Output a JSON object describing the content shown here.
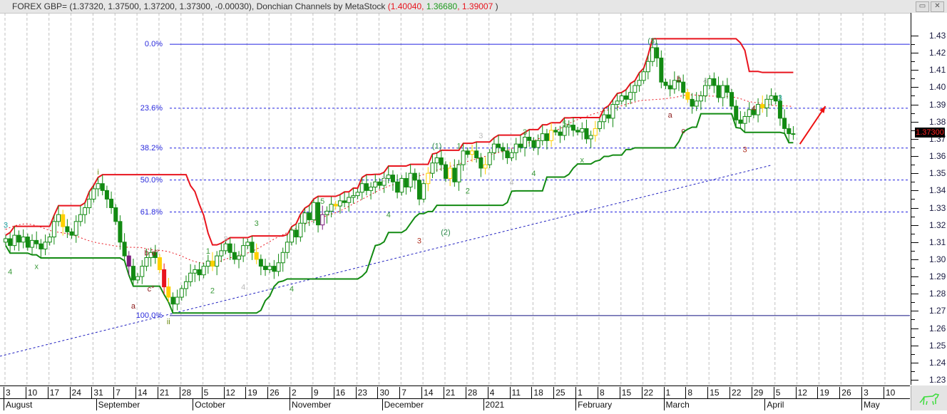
{
  "header": {
    "symbol": "FOREX GBP=",
    "ohlc_text": "(1.37320, 1.37500, 1.37200, 1.37300, -0.00030),",
    "indicator": "Donchian Channels by MetaStock",
    "ind_open": "(",
    "ind_upper": "1.40040",
    "ind_sep1": ",",
    "ind_lower": "1.36680",
    "ind_sep2": ",",
    "ind_mid": "1.39007",
    "ind_close": ")"
  },
  "window": {
    "restore_icon": "restore-icon",
    "close_icon": "close-icon",
    "restore": "▭",
    "close": "✕"
  },
  "last_price": "1.37300",
  "colors": {
    "upper": "#e8141e",
    "lower": "#128a12",
    "mid": "#e8141e",
    "candle": "#128a12",
    "fib": "#2020e0",
    "trend": "#2020c0",
    "arrow": "#ee1111"
  },
  "chart_data": {
    "type": "candlestick",
    "title": "FOREX GBP= Donchian Channels by MetaStock",
    "ylim": [
      1.225,
      1.435
    ],
    "y_ticks": [
      "1.43",
      "1.42",
      "1.41",
      "1.40",
      "1.39",
      "1.38",
      "1.37",
      "1.36",
      "1.35",
      "1.34",
      "1.33",
      "1.32",
      "1.31",
      "1.30",
      "1.29",
      "1.28",
      "1.27",
      "1.26",
      "1.25",
      "1.24",
      "1.23"
    ],
    "start_date": "2020-08-03",
    "week_labels": [
      "3",
      "10",
      "17",
      "24",
      "31",
      "7",
      "14",
      "21",
      "28",
      "5",
      "12",
      "19",
      "26",
      "2",
      "9",
      "16",
      "23",
      "30",
      "7",
      "14",
      "21",
      "28",
      "4",
      "11",
      "18",
      "25",
      "1",
      "8",
      "15",
      "22",
      "1",
      "8",
      "15",
      "22",
      "29",
      "5",
      "12",
      "19",
      "26",
      "3",
      "10"
    ],
    "months": [
      {
        "label": "August",
        "day_index": 0
      },
      {
        "label": "September",
        "day_index": 21
      },
      {
        "label": "October",
        "day_index": 43
      },
      {
        "label": "November",
        "day_index": 65
      },
      {
        "label": "December",
        "day_index": 86
      },
      {
        "label": "2021",
        "day_index": 109
      },
      {
        "label": "February",
        "day_index": 130
      },
      {
        "label": "March",
        "day_index": 150
      },
      {
        "label": "April",
        "day_index": 173
      },
      {
        "label": "May",
        "day_index": 195
      }
    ],
    "closes": [
      1.312,
      1.308,
      1.314,
      1.31,
      1.313,
      1.307,
      1.311,
      1.309,
      1.306,
      1.31,
      1.313,
      1.322,
      1.326,
      1.319,
      1.316,
      1.314,
      1.322,
      1.326,
      1.33,
      1.335,
      1.341,
      1.344,
      1.34,
      1.335,
      1.33,
      1.322,
      1.31,
      1.302,
      1.296,
      1.288,
      1.29,
      1.296,
      1.301,
      1.304,
      1.301,
      1.294,
      1.284,
      1.278,
      1.274,
      1.278,
      1.283,
      1.287,
      1.292,
      1.294,
      1.291,
      1.296,
      1.299,
      1.296,
      1.302,
      1.305,
      1.309,
      1.304,
      1.3,
      1.302,
      1.308,
      1.31,
      1.304,
      1.3,
      1.296,
      1.294,
      1.296,
      1.293,
      1.298,
      1.304,
      1.31,
      1.317,
      1.313,
      1.321,
      1.327,
      1.323,
      1.333,
      1.32,
      1.326,
      1.328,
      1.332,
      1.331,
      1.334,
      1.333,
      1.336,
      1.337,
      1.339,
      1.344,
      1.34,
      1.342,
      1.345,
      1.343,
      1.347,
      1.349,
      1.345,
      1.339,
      1.347,
      1.342,
      1.35,
      1.346,
      1.335,
      1.344,
      1.35,
      1.356,
      1.359,
      1.355,
      1.347,
      1.353,
      1.345,
      1.355,
      1.363,
      1.361,
      1.363,
      1.359,
      1.353,
      1.355,
      1.362,
      1.367,
      1.365,
      1.363,
      1.359,
      1.362,
      1.367,
      1.365,
      1.371,
      1.369,
      1.365,
      1.369,
      1.373,
      1.369,
      1.375,
      1.374,
      1.372,
      1.377,
      1.378,
      1.375,
      1.374,
      1.376,
      1.37,
      1.372,
      1.376,
      1.38,
      1.384,
      1.382,
      1.39,
      1.392,
      1.395,
      1.393,
      1.397,
      1.401,
      1.404,
      1.409,
      1.415,
      1.423,
      1.417,
      1.403,
      1.401,
      1.399,
      1.404,
      1.403,
      1.397,
      1.393,
      1.389,
      1.392,
      1.395,
      1.401,
      1.405,
      1.401,
      1.394,
      1.401,
      1.397,
      1.389,
      1.381,
      1.379,
      1.383,
      1.387,
      1.384,
      1.39,
      1.388,
      1.393,
      1.395,
      1.392,
      1.382,
      1.376,
      1.373,
      1.373
    ],
    "candle_highlights": [
      {
        "index": 13,
        "color": "#ffd000"
      },
      {
        "index": 28,
        "color": "#7a1a7a"
      },
      {
        "index": 35,
        "color": "#ffd000"
      },
      {
        "index": 36,
        "color": "#e8141e"
      },
      {
        "index": 37,
        "color": "#ffd000"
      },
      {
        "index": 47,
        "color": "#ffd000"
      },
      {
        "index": 57,
        "color": "#ffd000"
      },
      {
        "index": 72,
        "color": "#7a1a7a"
      },
      {
        "index": 75,
        "color": "#ffd000"
      },
      {
        "index": 96,
        "color": "#ffd000"
      },
      {
        "index": 101,
        "color": "#ffd000"
      },
      {
        "index": 106,
        "color": "#ffd000"
      },
      {
        "index": 109,
        "color": "#ffd000"
      },
      {
        "index": 124,
        "color": "#ffd000"
      },
      {
        "index": 134,
        "color": "#ffd000"
      },
      {
        "index": 155,
        "color": "#ffd000"
      },
      {
        "index": 172,
        "color": "#ffd000"
      }
    ],
    "donchian_period": 20,
    "fib_levels": [
      {
        "label": "0.0%",
        "price": 1.425,
        "style": "solid"
      },
      {
        "label": "23.6%",
        "price": 1.3878,
        "style": "dashed"
      },
      {
        "label": "38.2%",
        "price": 1.3647,
        "style": "dashed"
      },
      {
        "label": "50.0%",
        "price": 1.3461,
        "style": "dashed"
      },
      {
        "label": "61.8%",
        "price": 1.3275,
        "style": "dashed"
      },
      {
        "label": "100.0%",
        "price": 1.2673,
        "style": "solid"
      }
    ],
    "trendline": {
      "from": {
        "day_index": -1.3,
        "price": 1.2437
      },
      "to": {
        "day_index": 174,
        "price": 1.3547
      }
    },
    "arrow": {
      "from": {
        "day_index": 180.5,
        "price": 1.367
      },
      "to": {
        "day_index": 186.3,
        "price": 1.389
      }
    },
    "wave_labels": [
      {
        "text": "3",
        "i": 0,
        "p": 1.32,
        "color": "#1aa0a0"
      },
      {
        "text": "4",
        "i": 1,
        "p": 1.293,
        "color": "#3a9a3a"
      },
      {
        "text": "x",
        "i": 7,
        "p": 1.296,
        "color": "#3a9a3a"
      },
      {
        "text": "i",
        "i": 21,
        "p": 1.351,
        "color": "#6a8a10"
      },
      {
        "text": "b",
        "i": 32,
        "p": 1.304,
        "color": "#8b1a1a"
      },
      {
        "text": "d°",
        "i": 34,
        "p": 1.304,
        "color": "#8b1a1a"
      },
      {
        "text": "c°",
        "i": 33,
        "p": 1.283,
        "color": "#8b1a1a"
      },
      {
        "text": "a",
        "i": 29,
        "p": 1.273,
        "color": "#8b1a1a"
      },
      {
        "text": "ii",
        "i": 37,
        "p": 1.264,
        "color": "#6a8a10"
      },
      {
        "text": "1",
        "i": 46,
        "p": 1.305,
        "color": "#3a9a3a"
      },
      {
        "text": "2",
        "i": 47,
        "p": 1.282,
        "color": "#3a9a3a"
      },
      {
        "text": "3",
        "i": 50,
        "p": 1.312,
        "color": "#bbbbbb"
      },
      {
        "text": "4",
        "i": 54,
        "p": 1.284,
        "color": "#bbbbbb"
      },
      {
        "text": "3",
        "i": 57,
        "p": 1.321,
        "color": "#3a9a3a"
      },
      {
        "text": "4",
        "i": 65,
        "p": 1.283,
        "color": "#3a9a3a"
      },
      {
        "text": "5",
        "i": 72,
        "p": 1.334,
        "color": "#3a9a3a"
      },
      {
        "text": "3",
        "i": 86,
        "p": 1.347,
        "color": "#bbbbbb"
      },
      {
        "text": "4",
        "i": 87,
        "p": 1.326,
        "color": "#3a9a3a"
      },
      {
        "text": "3",
        "i": 94,
        "p": 1.311,
        "color": "#b03020"
      },
      {
        "text": "(1)",
        "i": 98,
        "p": 1.366,
        "color": "#2a8a4a"
      },
      {
        "text": "(2)",
        "i": 100,
        "p": 1.316,
        "color": "#2a8a4a"
      },
      {
        "text": "1",
        "i": 103,
        "p": 1.366,
        "color": "#3a9a3a"
      },
      {
        "text": "2",
        "i": 105,
        "p": 1.34,
        "color": "#3a9a3a"
      },
      {
        "text": "3",
        "i": 108,
        "p": 1.372,
        "color": "#bbbbbb"
      },
      {
        "text": "4",
        "i": 115,
        "p": 1.345,
        "color": "#bbbbbb"
      },
      {
        "text": "3",
        "i": 118,
        "p": 1.374,
        "color": "#3a9a3a"
      },
      {
        "text": "4",
        "i": 120,
        "p": 1.35,
        "color": "#3a9a3a"
      },
      {
        "text": "5",
        "i": 127,
        "p": 1.379,
        "color": "#3a9a3a"
      },
      {
        "text": "x",
        "i": 131,
        "p": 1.358,
        "color": "#3a9a3a"
      },
      {
        "text": "(3)",
        "i": 147,
        "p": 1.427,
        "color": "#2a8a4a"
      },
      {
        "text": "a",
        "i": 151,
        "p": 1.384,
        "color": "#8b1a1a"
      },
      {
        "text": "b",
        "i": 153,
        "p": 1.405,
        "color": "#8b1a1a"
      },
      {
        "text": "c",
        "i": 154,
        "p": 1.375,
        "color": "#8b1a1a"
      },
      {
        "text": "4",
        "i": 159,
        "p": 1.404,
        "color": "#bbbbbb"
      },
      {
        "text": "3",
        "i": 168,
        "p": 1.364,
        "color": "#b03020"
      },
      {
        "text": "4",
        "i": 170,
        "p": 1.388,
        "color": "#b03020"
      },
      {
        "text": "3",
        "i": 176,
        "p": 1.394,
        "color": "#1aa0a0"
      }
    ]
  }
}
